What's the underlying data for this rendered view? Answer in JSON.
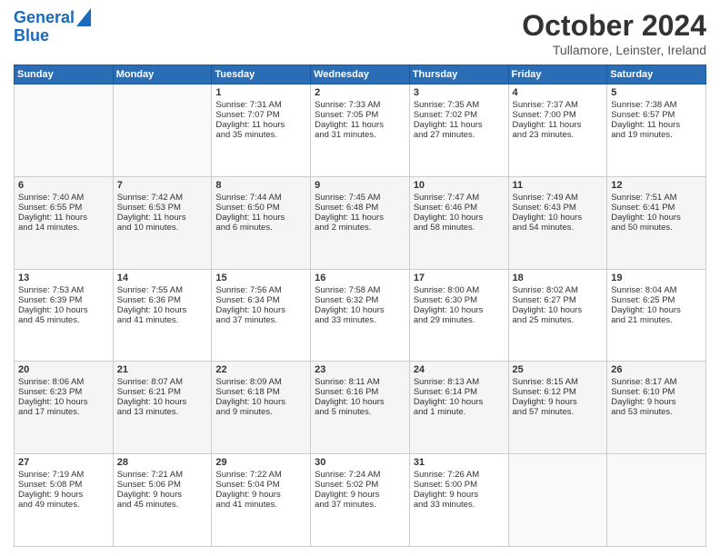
{
  "header": {
    "logo_line1": "General",
    "logo_line2": "Blue",
    "title": "October 2024",
    "location": "Tullamore, Leinster, Ireland"
  },
  "days_of_week": [
    "Sunday",
    "Monday",
    "Tuesday",
    "Wednesday",
    "Thursday",
    "Friday",
    "Saturday"
  ],
  "weeks": [
    [
      {
        "day": "",
        "content": ""
      },
      {
        "day": "",
        "content": ""
      },
      {
        "day": "1",
        "content": "Sunrise: 7:31 AM\nSunset: 7:07 PM\nDaylight: 11 hours\nand 35 minutes."
      },
      {
        "day": "2",
        "content": "Sunrise: 7:33 AM\nSunset: 7:05 PM\nDaylight: 11 hours\nand 31 minutes."
      },
      {
        "day": "3",
        "content": "Sunrise: 7:35 AM\nSunset: 7:02 PM\nDaylight: 11 hours\nand 27 minutes."
      },
      {
        "day": "4",
        "content": "Sunrise: 7:37 AM\nSunset: 7:00 PM\nDaylight: 11 hours\nand 23 minutes."
      },
      {
        "day": "5",
        "content": "Sunrise: 7:38 AM\nSunset: 6:57 PM\nDaylight: 11 hours\nand 19 minutes."
      }
    ],
    [
      {
        "day": "6",
        "content": "Sunrise: 7:40 AM\nSunset: 6:55 PM\nDaylight: 11 hours\nand 14 minutes."
      },
      {
        "day": "7",
        "content": "Sunrise: 7:42 AM\nSunset: 6:53 PM\nDaylight: 11 hours\nand 10 minutes."
      },
      {
        "day": "8",
        "content": "Sunrise: 7:44 AM\nSunset: 6:50 PM\nDaylight: 11 hours\nand 6 minutes."
      },
      {
        "day": "9",
        "content": "Sunrise: 7:45 AM\nSunset: 6:48 PM\nDaylight: 11 hours\nand 2 minutes."
      },
      {
        "day": "10",
        "content": "Sunrise: 7:47 AM\nSunset: 6:46 PM\nDaylight: 10 hours\nand 58 minutes."
      },
      {
        "day": "11",
        "content": "Sunrise: 7:49 AM\nSunset: 6:43 PM\nDaylight: 10 hours\nand 54 minutes."
      },
      {
        "day": "12",
        "content": "Sunrise: 7:51 AM\nSunset: 6:41 PM\nDaylight: 10 hours\nand 50 minutes."
      }
    ],
    [
      {
        "day": "13",
        "content": "Sunrise: 7:53 AM\nSunset: 6:39 PM\nDaylight: 10 hours\nand 45 minutes."
      },
      {
        "day": "14",
        "content": "Sunrise: 7:55 AM\nSunset: 6:36 PM\nDaylight: 10 hours\nand 41 minutes."
      },
      {
        "day": "15",
        "content": "Sunrise: 7:56 AM\nSunset: 6:34 PM\nDaylight: 10 hours\nand 37 minutes."
      },
      {
        "day": "16",
        "content": "Sunrise: 7:58 AM\nSunset: 6:32 PM\nDaylight: 10 hours\nand 33 minutes."
      },
      {
        "day": "17",
        "content": "Sunrise: 8:00 AM\nSunset: 6:30 PM\nDaylight: 10 hours\nand 29 minutes."
      },
      {
        "day": "18",
        "content": "Sunrise: 8:02 AM\nSunset: 6:27 PM\nDaylight: 10 hours\nand 25 minutes."
      },
      {
        "day": "19",
        "content": "Sunrise: 8:04 AM\nSunset: 6:25 PM\nDaylight: 10 hours\nand 21 minutes."
      }
    ],
    [
      {
        "day": "20",
        "content": "Sunrise: 8:06 AM\nSunset: 6:23 PM\nDaylight: 10 hours\nand 17 minutes."
      },
      {
        "day": "21",
        "content": "Sunrise: 8:07 AM\nSunset: 6:21 PM\nDaylight: 10 hours\nand 13 minutes."
      },
      {
        "day": "22",
        "content": "Sunrise: 8:09 AM\nSunset: 6:18 PM\nDaylight: 10 hours\nand 9 minutes."
      },
      {
        "day": "23",
        "content": "Sunrise: 8:11 AM\nSunset: 6:16 PM\nDaylight: 10 hours\nand 5 minutes."
      },
      {
        "day": "24",
        "content": "Sunrise: 8:13 AM\nSunset: 6:14 PM\nDaylight: 10 hours\nand 1 minute."
      },
      {
        "day": "25",
        "content": "Sunrise: 8:15 AM\nSunset: 6:12 PM\nDaylight: 9 hours\nand 57 minutes."
      },
      {
        "day": "26",
        "content": "Sunrise: 8:17 AM\nSunset: 6:10 PM\nDaylight: 9 hours\nand 53 minutes."
      }
    ],
    [
      {
        "day": "27",
        "content": "Sunrise: 7:19 AM\nSunset: 5:08 PM\nDaylight: 9 hours\nand 49 minutes."
      },
      {
        "day": "28",
        "content": "Sunrise: 7:21 AM\nSunset: 5:06 PM\nDaylight: 9 hours\nand 45 minutes."
      },
      {
        "day": "29",
        "content": "Sunrise: 7:22 AM\nSunset: 5:04 PM\nDaylight: 9 hours\nand 41 minutes."
      },
      {
        "day": "30",
        "content": "Sunrise: 7:24 AM\nSunset: 5:02 PM\nDaylight: 9 hours\nand 37 minutes."
      },
      {
        "day": "31",
        "content": "Sunrise: 7:26 AM\nSunset: 5:00 PM\nDaylight: 9 hours\nand 33 minutes."
      },
      {
        "day": "",
        "content": ""
      },
      {
        "day": "",
        "content": ""
      }
    ]
  ]
}
